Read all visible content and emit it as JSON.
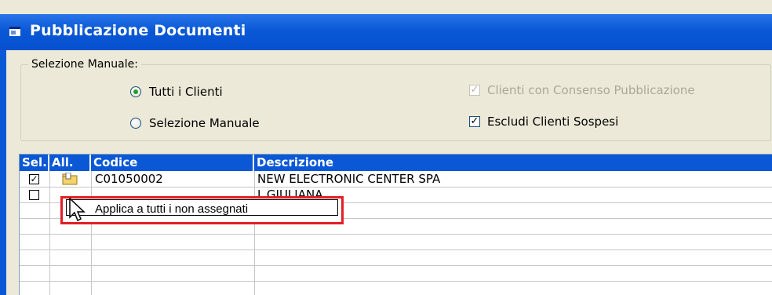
{
  "window": {
    "title": "Pubblicazione Documenti",
    "title_icon": "document-window-icon",
    "titlebar_color": "#0a58d6"
  },
  "selection": {
    "legend": "Selezione Manuale:",
    "radio_all": {
      "label": "Tutti i Clienti",
      "checked": true
    },
    "radio_manual": {
      "label": "Selezione Manuale",
      "checked": false
    },
    "check_consent": {
      "label": "Clienti con Consenso Pubblicazione",
      "checked": true,
      "disabled": true
    },
    "check_suspended": {
      "label": "Escludi Clienti Sospesi",
      "checked": true,
      "disabled": false
    }
  },
  "grid": {
    "headers": [
      "Sel.",
      "All.",
      "Codice",
      "Descrizione"
    ],
    "rows": [
      {
        "selected": true,
        "attachment_icon": "folder-attachment-icon",
        "codice": "C01050002",
        "descrizione": "NEW ELECTRONIC CENTER SPA"
      },
      {
        "selected": false,
        "attachment_icon": "",
        "codice": "",
        "descrizione": "I_GIULIANA"
      }
    ]
  },
  "tooltip": {
    "text": "Applica a tutti i non assegnati",
    "highlight_color": "#e31e24"
  }
}
